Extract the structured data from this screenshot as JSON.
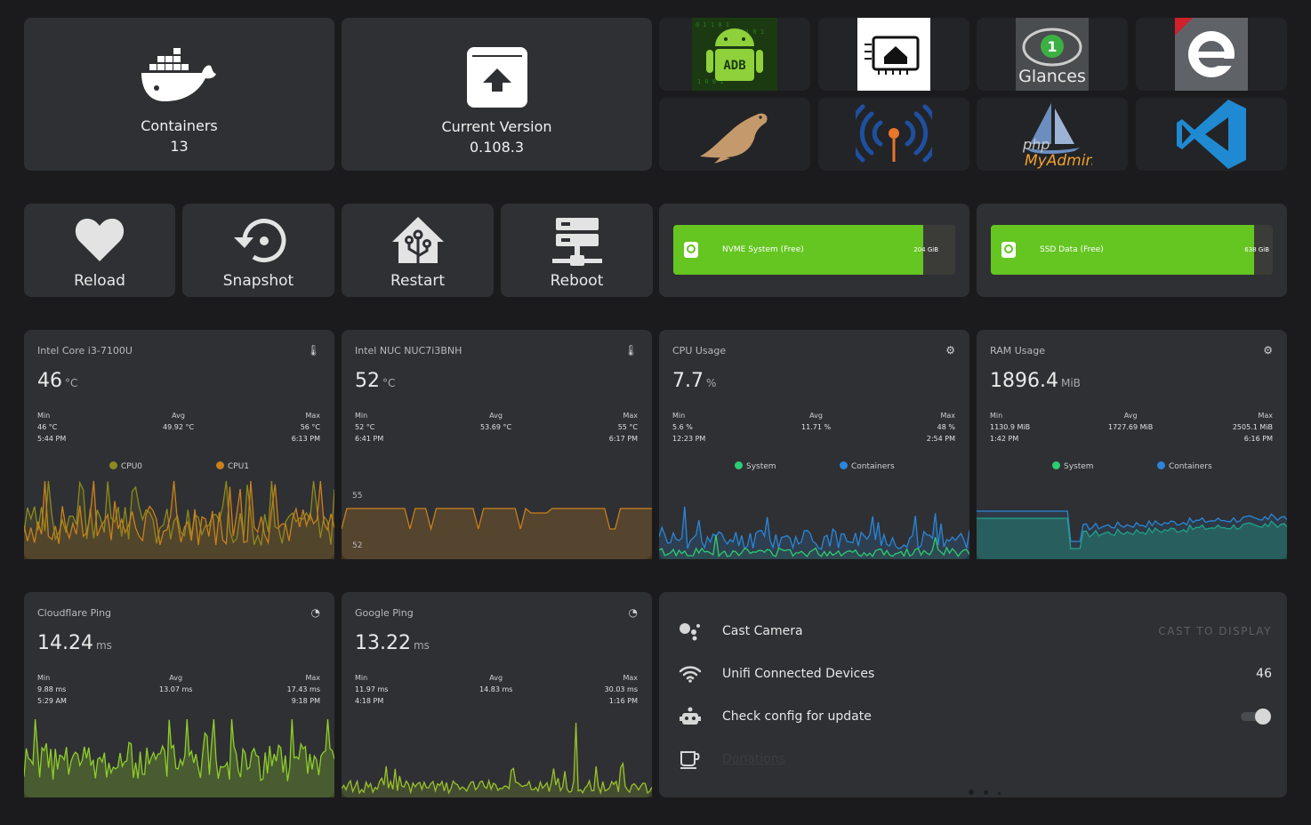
{
  "tiles": {
    "containers": {
      "label": "Containers",
      "value": "13"
    },
    "version": {
      "label": "Current Version",
      "value": "0.108.3"
    }
  },
  "apps": [
    {
      "name": "adb-android-icon",
      "text": "ADB"
    },
    {
      "name": "esphome-icon",
      "text": ""
    },
    {
      "name": "glances-icon",
      "text": "Glances"
    },
    {
      "name": "ebook-e-icon",
      "text": "e"
    },
    {
      "name": "mariadb-seal-icon",
      "text": ""
    },
    {
      "name": "wifi-antenna-icon",
      "text": ""
    },
    {
      "name": "phpmyadmin-icon",
      "text": "phpMyAdmin"
    },
    {
      "name": "vscode-icon",
      "text": ""
    }
  ],
  "buttons": {
    "reload": "Reload",
    "snapshot": "Snapshot",
    "restart": "Restart",
    "reboot": "Reboot"
  },
  "disks": [
    {
      "label": "NVME System (Free)",
      "value": "204 GiB",
      "fraction": 0.885
    },
    {
      "label": "SSD Data (Free)",
      "value": "638 GiB",
      "fraction": 0.935
    }
  ],
  "sensors": {
    "cpu_temp": {
      "title": "Intel Core i3-7100U",
      "value": "46",
      "unit": "°C",
      "min": "46 °C",
      "min_time": "5:44 PM",
      "avg": "49.92 °C",
      "max": "56 °C",
      "max_time": "6:13 PM",
      "legend": [
        "CPU0",
        "CPU1"
      ]
    },
    "nuc_temp": {
      "title": "Intel NUC NUC7i3BNH",
      "value": "52",
      "unit": "°C",
      "min": "52 °C",
      "min_time": "6:41 PM",
      "avg": "53.69 °C",
      "max": "55 °C",
      "max_time": "6:17 PM",
      "y_hi": "55",
      "y_lo": "52"
    },
    "cpu_usage": {
      "title": "CPU Usage",
      "value": "7.7",
      "unit": "%",
      "min": "5.6 %",
      "min_time": "12:23 PM",
      "avg": "11.71 %",
      "max": "48 %",
      "max_time": "2:54 PM",
      "legend": [
        "System",
        "Containers"
      ]
    },
    "ram_usage": {
      "title": "RAM Usage",
      "value": "1896.4",
      "unit": "MiB",
      "min": "1130.9 MiB",
      "min_time": "1:42 PM",
      "avg": "1727.69 MiB",
      "max": "2505.1 MiB",
      "max_time": "6:16 PM",
      "legend": [
        "System",
        "Containers"
      ]
    },
    "cloudflare_ping": {
      "title": "Cloudflare Ping",
      "value": "14.24",
      "unit": "ms",
      "min": "9.88 ms",
      "min_time": "5:29 AM",
      "avg": "13.07 ms",
      "max": "17.43 ms",
      "max_time": "9:18 PM"
    },
    "google_ping": {
      "title": "Google Ping",
      "value": "13.22",
      "unit": "ms",
      "min": "11.97 ms",
      "min_time": "4:18 PM",
      "avg": "14.83 ms",
      "max": "30.03 ms",
      "max_time": "1:16 PM"
    }
  },
  "stat_labels": {
    "min": "Min",
    "avg": "Avg",
    "max": "Max"
  },
  "entities": {
    "cast": {
      "name": "Cast Camera",
      "action": "CAST TO DISPLAY"
    },
    "unifi": {
      "name": "Unifi Connected Devices",
      "value": "46"
    },
    "config": {
      "name": "Check config for update",
      "state": true
    },
    "donations": {
      "name": "Donations"
    }
  },
  "colors": {
    "accent": "#65c521",
    "cpu0": "#8a8a1e",
    "cpu1": "#c9801a",
    "system": "#2ecc71",
    "containers": "#2a86d9"
  }
}
